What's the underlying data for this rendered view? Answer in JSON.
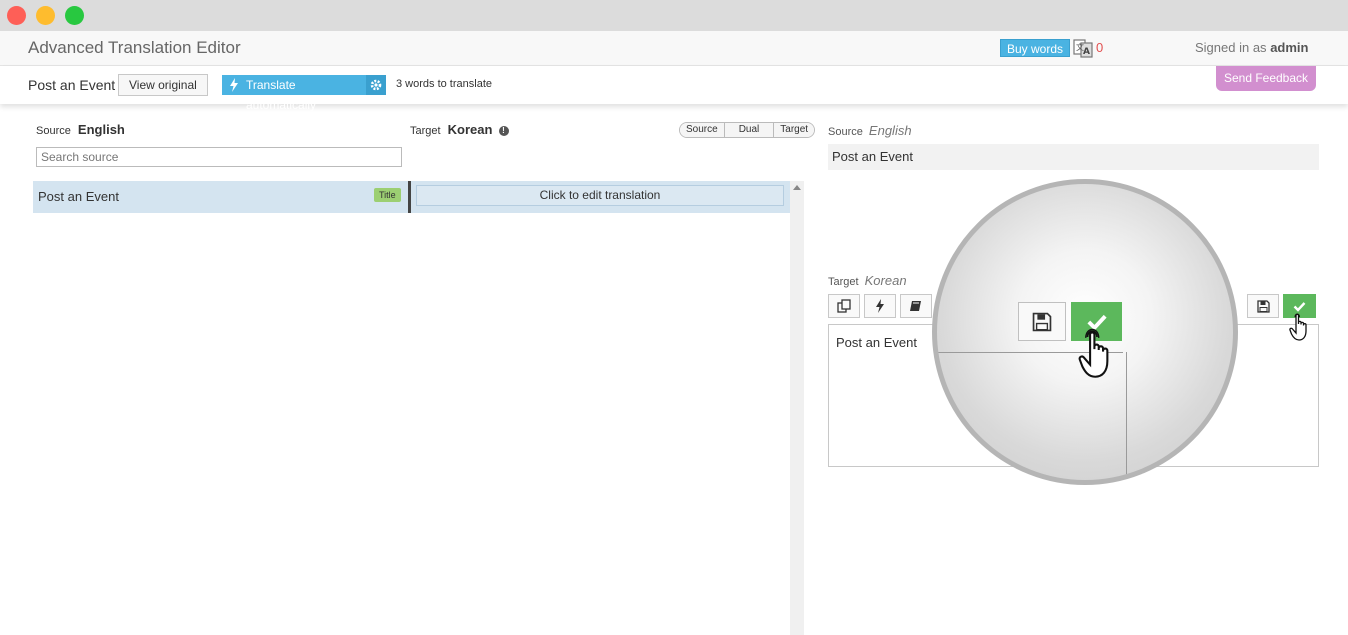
{
  "app": {
    "title": "Advanced Translation Editor",
    "buy_words": "Buy words",
    "credits": "0",
    "signed_in_prefix": "Signed in as",
    "user": "admin"
  },
  "toolbar": {
    "document_title": "Post an Event",
    "view_original": "View original",
    "translate_automatically": "Translate automatically",
    "words_to_translate": "3 words to translate",
    "send_feedback": "Send Feedback"
  },
  "left_panel": {
    "source_label": "Source",
    "source_lang": "English",
    "target_label": "Target",
    "target_lang": "Korean",
    "view_modes": [
      "Source",
      "Dual",
      "Target"
    ],
    "search_placeholder": "Search source",
    "rows": [
      {
        "source": "Post an Event",
        "badge": "Title",
        "translation_prompt": "Click to edit translation"
      }
    ]
  },
  "right_panel": {
    "source_label": "Source",
    "source_lang": "English",
    "source_text": "Post an Event",
    "target_label": "Target",
    "target_lang": "Korean",
    "target_text": "Post an Event",
    "tools": [
      "copy-icon",
      "bolt-icon",
      "book-icon"
    ]
  },
  "colors": {
    "accent_blue": "#4ab3e2",
    "feedback_purple": "#d28fcf",
    "save_green": "#5cb85c",
    "row_highlight": "#d4e4f0"
  }
}
